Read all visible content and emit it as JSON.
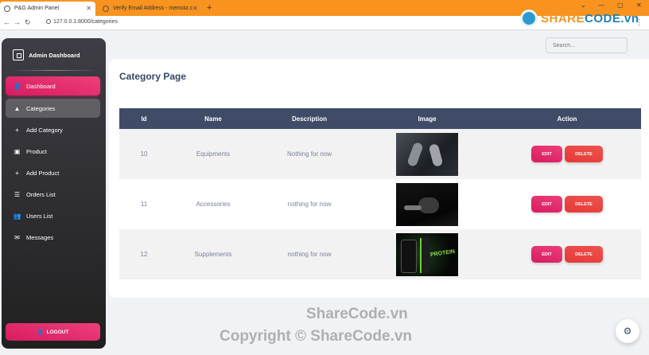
{
  "browser": {
    "tabs": [
      {
        "title": "P&G Admin Panel"
      },
      {
        "title": "Verify Email Address - memoiz.c"
      }
    ],
    "new_tab": "+",
    "url": "127.0.0.1:8000/categories",
    "window_controls": [
      "⌄",
      "—",
      "▢",
      "✕"
    ]
  },
  "watermark_logo": {
    "left": "SHARE",
    "right": "CODE.vn"
  },
  "sidebar": {
    "brand": "Admin Dashboard",
    "items": [
      {
        "label": "Dashboard",
        "icon": "person-icon",
        "glyph": "👤"
      },
      {
        "label": "Categories",
        "icon": "category-icon",
        "glyph": "▲"
      },
      {
        "label": "Add Category",
        "icon": "add-circle-icon",
        "glyph": "+"
      },
      {
        "label": "Product",
        "icon": "inventory-icon",
        "glyph": "▣"
      },
      {
        "label": "Add Product",
        "icon": "add-circle-icon",
        "glyph": "+"
      },
      {
        "label": "Orders List",
        "icon": "list-icon",
        "glyph": "☰"
      },
      {
        "label": "Users List",
        "icon": "group-icon",
        "glyph": "👥"
      },
      {
        "label": "Messages",
        "icon": "message-icon",
        "glyph": "✉"
      }
    ],
    "logout": "LOGOUT"
  },
  "search": {
    "placeholder": "Search..."
  },
  "page": {
    "title": "Category Page"
  },
  "table": {
    "headers": [
      "Id",
      "Name",
      "Description",
      "Image",
      "Action"
    ],
    "rows": [
      {
        "id": "10",
        "name": "Equipments",
        "description": "Nothing for now"
      },
      {
        "id": "11",
        "name": "Accessories",
        "description": "nothing for now"
      },
      {
        "id": "12",
        "name": "Supplements",
        "description": "nothing for now",
        "image_text": "PROTEIN"
      }
    ],
    "edit_label": "EDIT",
    "delete_label": "DELETE"
  },
  "watermark": {
    "line1": "ShareCode.vn",
    "line2": "Copyright © ShareCode.vn"
  }
}
